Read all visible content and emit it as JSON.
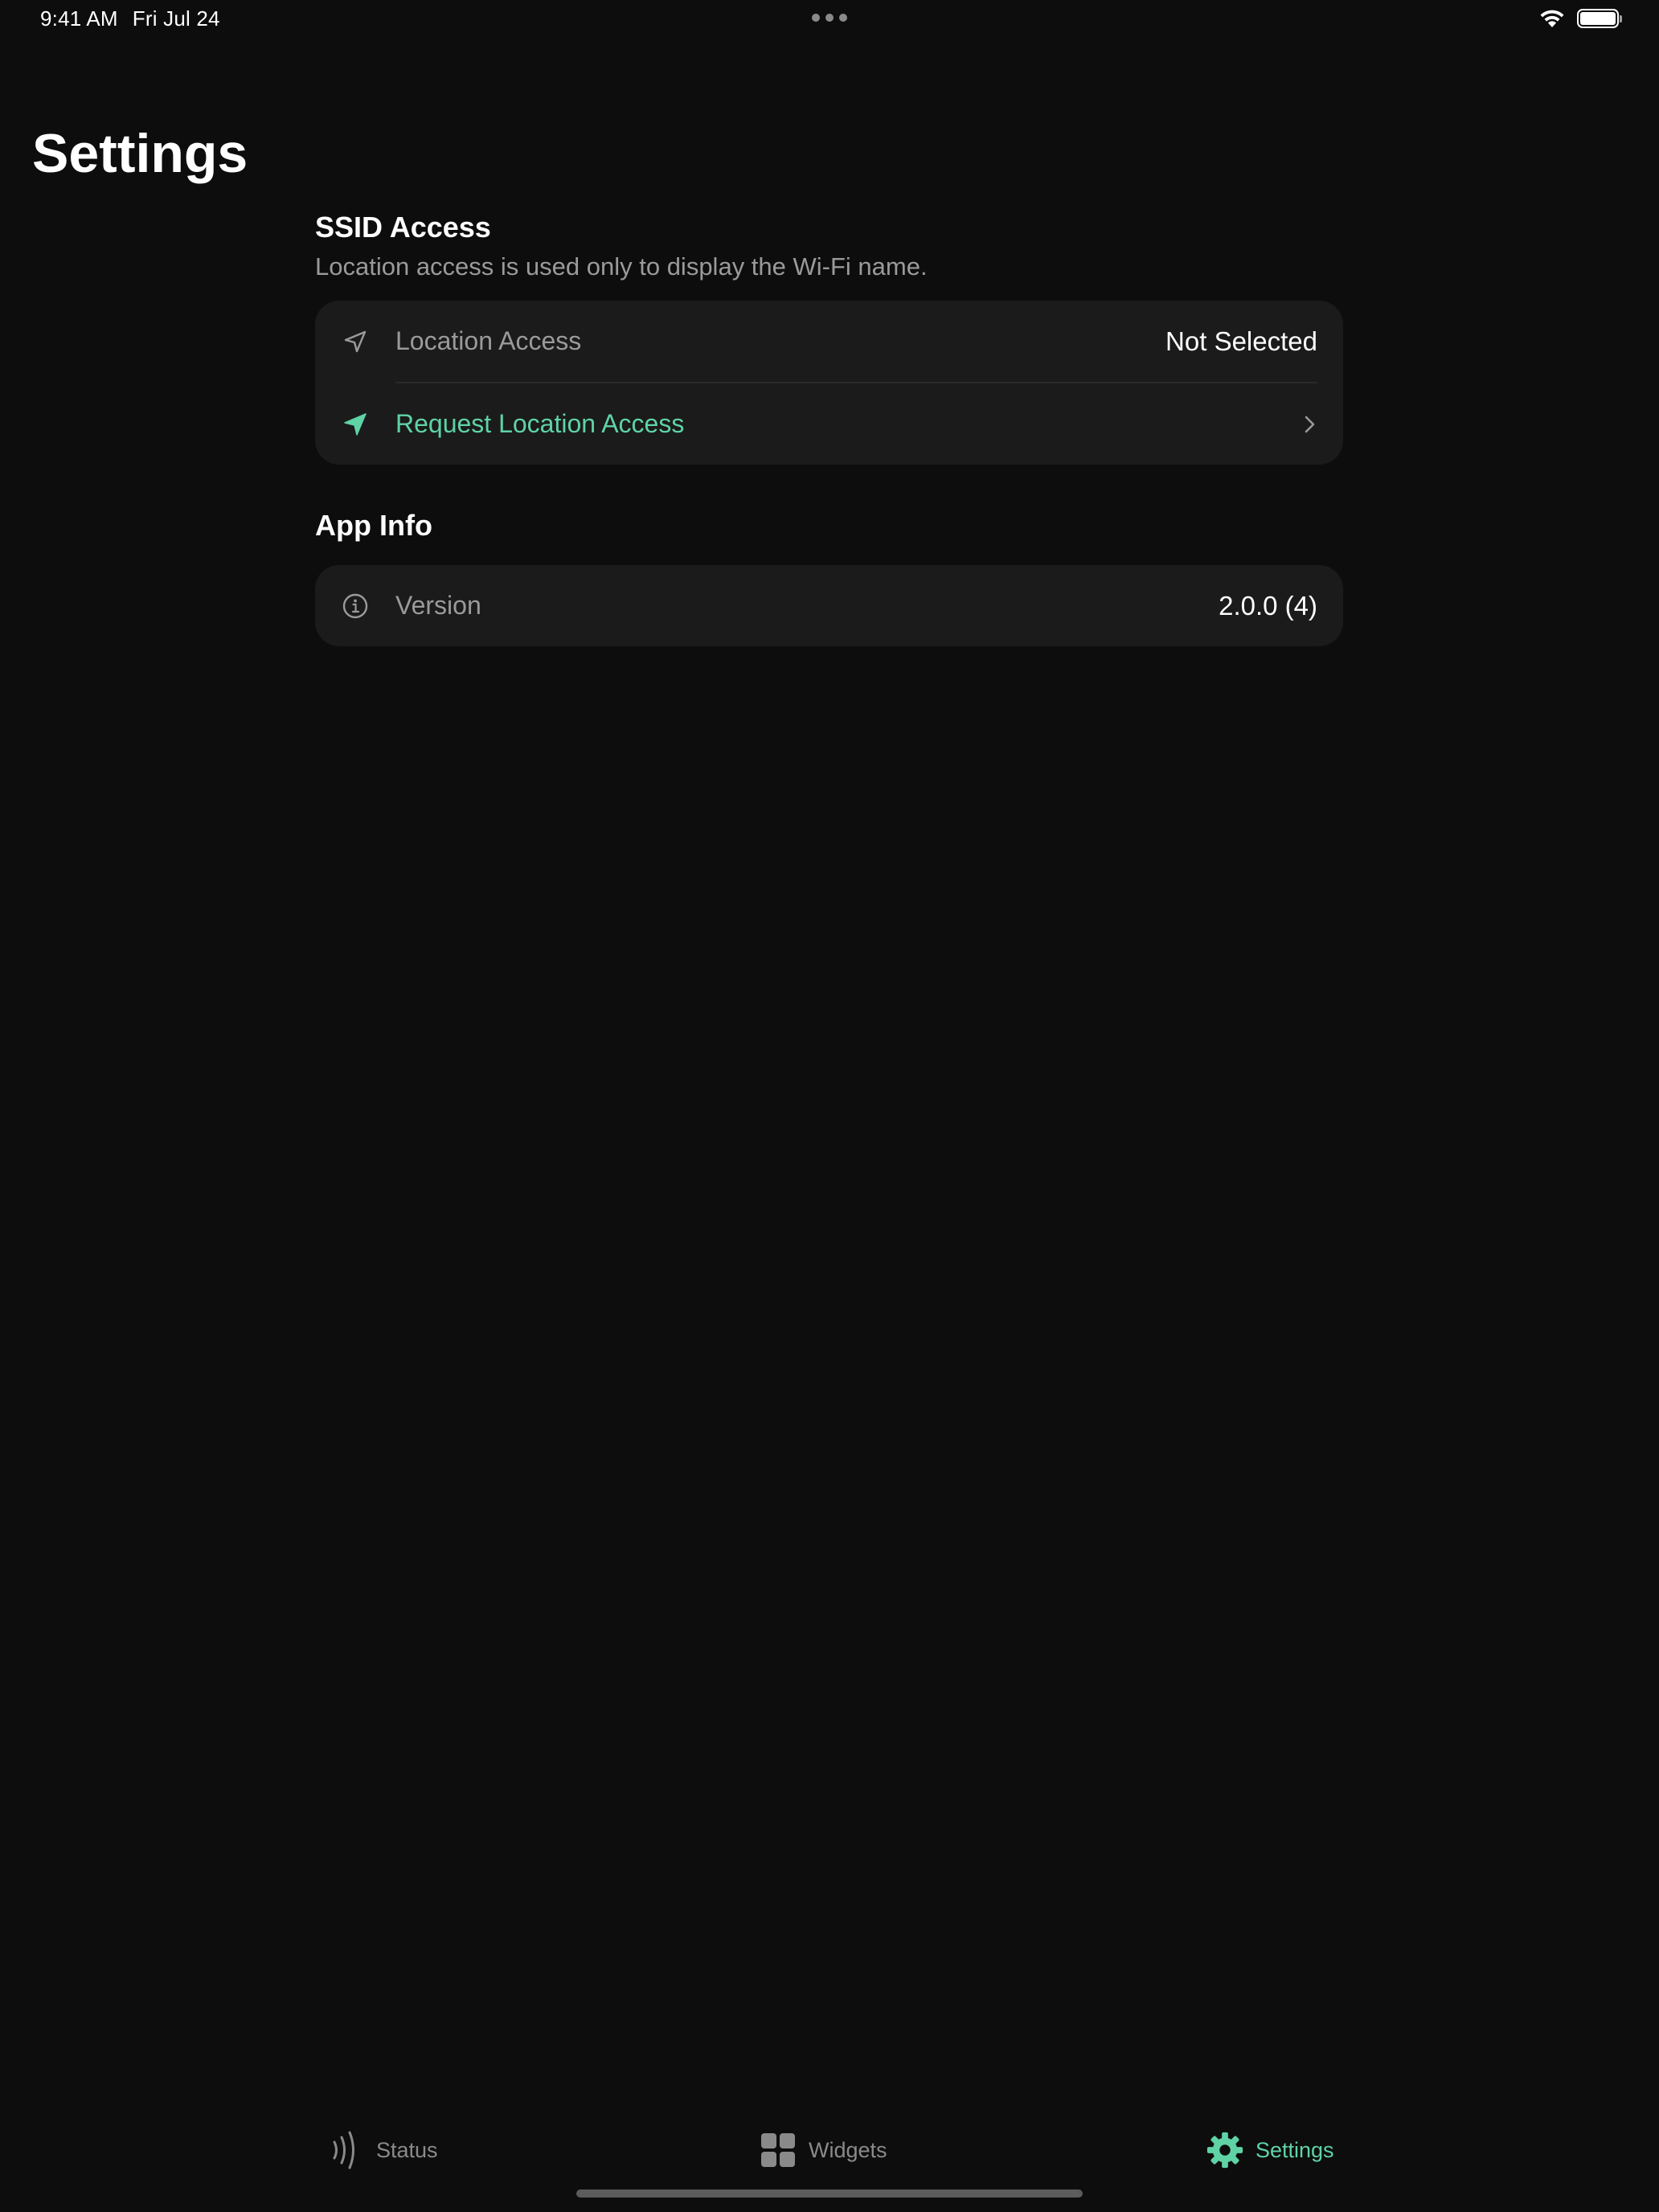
{
  "status_bar": {
    "time": "9:41 AM",
    "date": "Fri Jul 24"
  },
  "page": {
    "title": "Settings"
  },
  "sections": {
    "ssid": {
      "header": "SSID Access",
      "subtitle": "Location access is used only to display the Wi-Fi name.",
      "location_access": {
        "label": "Location Access",
        "value": "Not Selected",
        "icon": "location-arrow-outline-icon"
      },
      "request": {
        "label": "Request Location Access",
        "icon": "location-arrow-filled-icon"
      }
    },
    "app_info": {
      "header": "App Info",
      "version": {
        "label": "Version",
        "value": "2.0.0 (4)",
        "icon": "info-circle-icon"
      }
    }
  },
  "tab_bar": {
    "tabs": [
      {
        "label": "Status",
        "icon": "signal-waves-icon",
        "active": false
      },
      {
        "label": "Widgets",
        "icon": "widgets-grid-icon",
        "active": false
      },
      {
        "label": "Settings",
        "icon": "gear-icon",
        "active": true
      }
    ]
  },
  "colors": {
    "background": "#0d0d0d",
    "card": "#1b1b1b",
    "accent": "#5fd3a6",
    "secondary_text": "#9a9a9a"
  }
}
